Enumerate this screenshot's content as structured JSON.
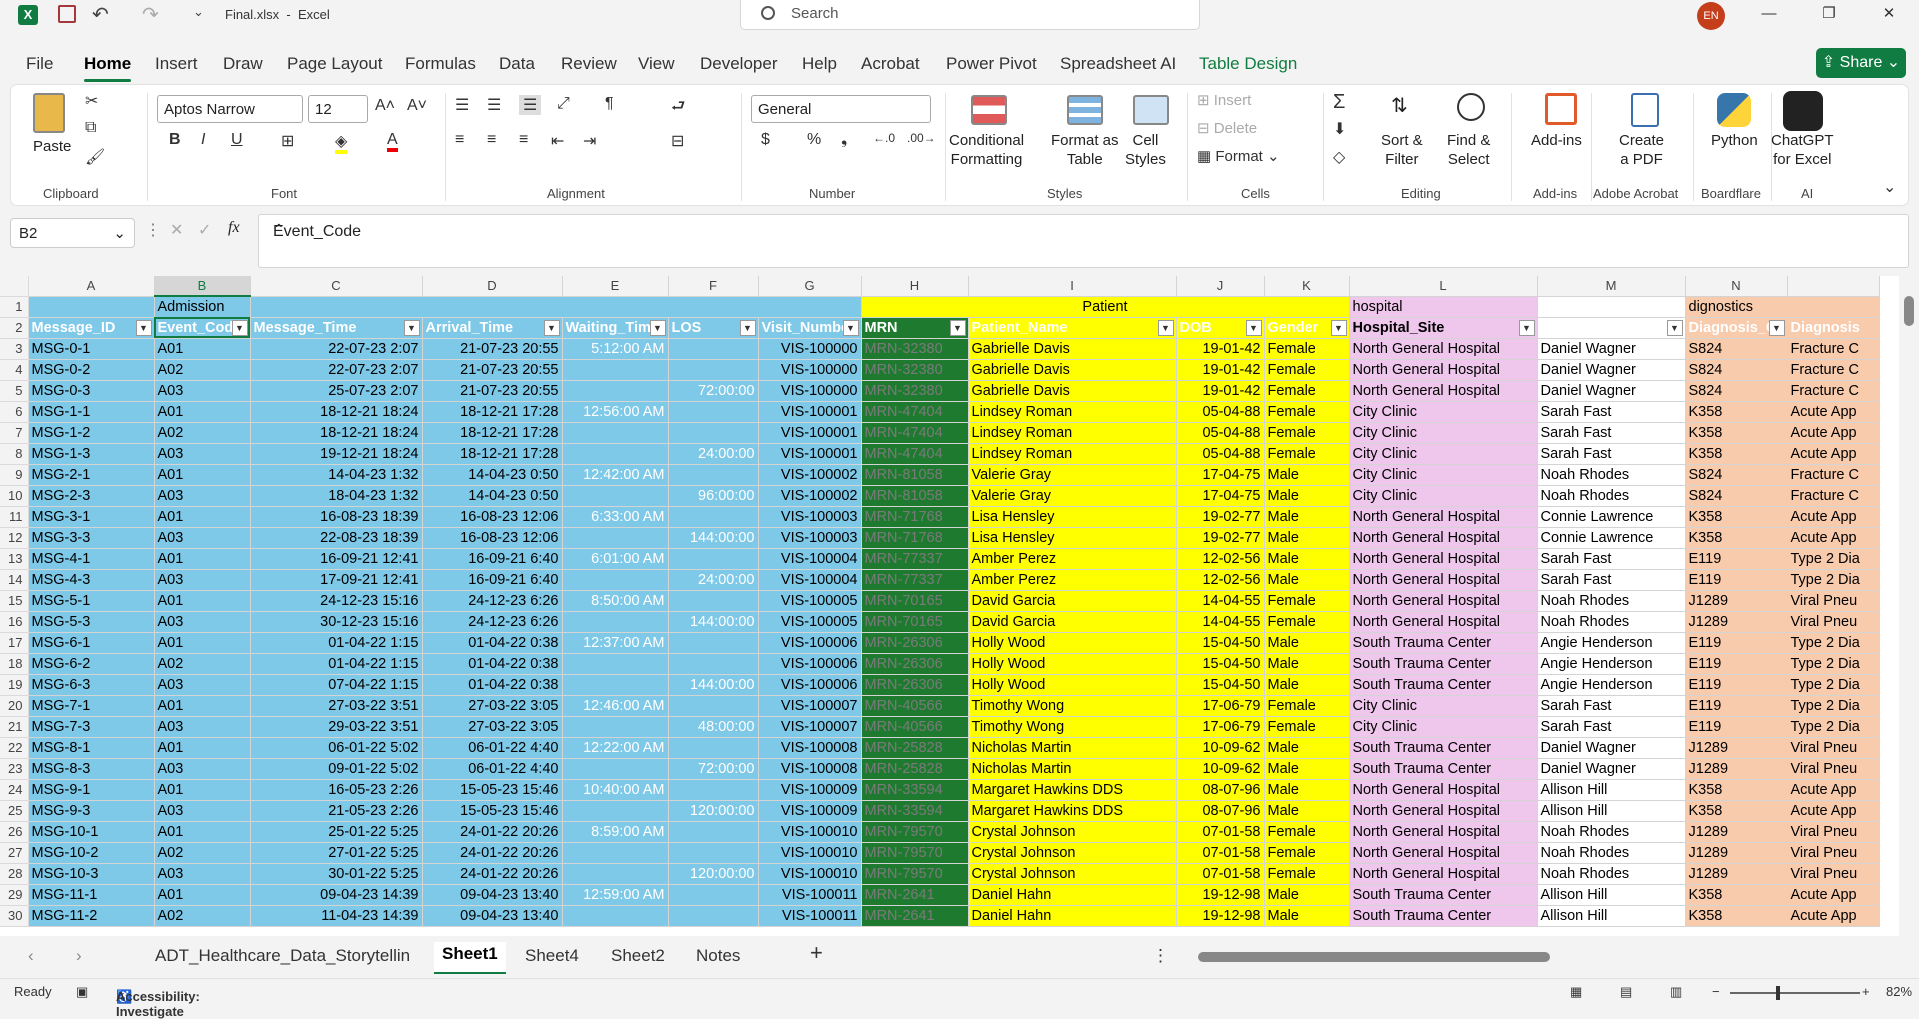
{
  "title": {
    "file": "Final.xlsx",
    "app": "Excel",
    "search": "Search",
    "user": "EN"
  },
  "menu": [
    "File",
    "Home",
    "Insert",
    "Draw",
    "Page Layout",
    "Formulas",
    "Data",
    "Review",
    "View",
    "Developer",
    "Help",
    "Acrobat",
    "Power Pivot",
    "Spreadsheet AI",
    "Table Design"
  ],
  "share": "Share",
  "ribbon": {
    "clipboard": {
      "label": "Clipboard",
      "paste": "Paste"
    },
    "font": {
      "label": "Font",
      "name": "Aptos Narrow",
      "size": "12"
    },
    "alignment": {
      "label": "Alignment"
    },
    "number": {
      "label": "Number",
      "format": "General"
    },
    "styles": {
      "label": "Styles",
      "conditional": "Conditional\nFormatting",
      "format_table": "Format as\nTable",
      "cell_styles": "Cell\nStyles"
    },
    "cells": {
      "label": "Cells",
      "insert": "Insert",
      "delete": "Delete",
      "format": "Format"
    },
    "editing": {
      "label": "Editing",
      "sort": "Sort &\nFilter",
      "find": "Find &\nSelect"
    },
    "addins": {
      "label": "Add-ins",
      "btn": "Add-ins"
    },
    "acrobat": {
      "label": "Adobe Acrobat",
      "btn": "Create\na PDF"
    },
    "boardflare": {
      "label": "Boardflare",
      "btn": "Python"
    },
    "ai": {
      "label": "AI",
      "btn": "ChatGPT\nfor Excel"
    }
  },
  "formula": {
    "cell": "B2",
    "value": "Event_Code"
  },
  "columns": [
    "A",
    "B",
    "C",
    "D",
    "E",
    "F",
    "G",
    "H",
    "I",
    "J",
    "K",
    "L",
    "M",
    "N"
  ],
  "group_headers": {
    "admission": "Admission",
    "patient": "Patient",
    "hospital": "hospital",
    "diagnostics": "dignostics"
  },
  "headers": [
    "Message_ID",
    "Event_Cod",
    "Message_Time",
    "Arrival_Time",
    "Waiting_Tim",
    "LOS",
    "Visit_Numbe",
    "MRN",
    "Patient_Name",
    "DOB",
    "Gender",
    "Hospital_Site",
    "",
    "Diagnosis_C",
    "Diagnosis"
  ],
  "rows": [
    [
      "MSG-0-1",
      "A01",
      "22-07-23 2:07",
      "21-07-23 20:55",
      "5:12:00 AM",
      "",
      "VIS-100000",
      "MRN-32380",
      "Gabrielle Davis",
      "19-01-42",
      "Female",
      "North General Hospital",
      "Daniel Wagner",
      "S824",
      "Fracture C"
    ],
    [
      "MSG-0-2",
      "A02",
      "22-07-23 2:07",
      "21-07-23 20:55",
      "",
      "",
      "VIS-100000",
      "MRN-32380",
      "Gabrielle Davis",
      "19-01-42",
      "Female",
      "North General Hospital",
      "Daniel Wagner",
      "S824",
      "Fracture C"
    ],
    [
      "MSG-0-3",
      "A03",
      "25-07-23 2:07",
      "21-07-23 20:55",
      "",
      "72:00:00",
      "VIS-100000",
      "MRN-32380",
      "Gabrielle Davis",
      "19-01-42",
      "Female",
      "North General Hospital",
      "Daniel Wagner",
      "S824",
      "Fracture C"
    ],
    [
      "MSG-1-1",
      "A01",
      "18-12-21 18:24",
      "18-12-21 17:28",
      "12:56:00 AM",
      "",
      "VIS-100001",
      "MRN-47404",
      "Lindsey Roman",
      "05-04-88",
      "Female",
      "City Clinic",
      "Sarah Fast",
      "K358",
      "Acute App"
    ],
    [
      "MSG-1-2",
      "A02",
      "18-12-21 18:24",
      "18-12-21 17:28",
      "",
      "",
      "VIS-100001",
      "MRN-47404",
      "Lindsey Roman",
      "05-04-88",
      "Female",
      "City Clinic",
      "Sarah Fast",
      "K358",
      "Acute App"
    ],
    [
      "MSG-1-3",
      "A03",
      "19-12-21 18:24",
      "18-12-21 17:28",
      "",
      "24:00:00",
      "VIS-100001",
      "MRN-47404",
      "Lindsey Roman",
      "05-04-88",
      "Female",
      "City Clinic",
      "Sarah Fast",
      "K358",
      "Acute App"
    ],
    [
      "MSG-2-1",
      "A01",
      "14-04-23 1:32",
      "14-04-23 0:50",
      "12:42:00 AM",
      "",
      "VIS-100002",
      "MRN-81058",
      "Valerie Gray",
      "17-04-75",
      "Male",
      "City Clinic",
      "Noah Rhodes",
      "S824",
      "Fracture C"
    ],
    [
      "MSG-2-3",
      "A03",
      "18-04-23 1:32",
      "14-04-23 0:50",
      "",
      "96:00:00",
      "VIS-100002",
      "MRN-81058",
      "Valerie Gray",
      "17-04-75",
      "Male",
      "City Clinic",
      "Noah Rhodes",
      "S824",
      "Fracture C"
    ],
    [
      "MSG-3-1",
      "A01",
      "16-08-23 18:39",
      "16-08-23 12:06",
      "6:33:00 AM",
      "",
      "VIS-100003",
      "MRN-71768",
      "Lisa Hensley",
      "19-02-77",
      "Male",
      "North General Hospital",
      "Connie Lawrence",
      "K358",
      "Acute App"
    ],
    [
      "MSG-3-3",
      "A03",
      "22-08-23 18:39",
      "16-08-23 12:06",
      "",
      "144:00:00",
      "VIS-100003",
      "MRN-71768",
      "Lisa Hensley",
      "19-02-77",
      "Male",
      "North General Hospital",
      "Connie Lawrence",
      "K358",
      "Acute App"
    ],
    [
      "MSG-4-1",
      "A01",
      "16-09-21 12:41",
      "16-09-21 6:40",
      "6:01:00 AM",
      "",
      "VIS-100004",
      "MRN-77337",
      "Amber Perez",
      "12-02-56",
      "Male",
      "North General Hospital",
      "Sarah Fast",
      "E119",
      "Type 2 Dia"
    ],
    [
      "MSG-4-3",
      "A03",
      "17-09-21 12:41",
      "16-09-21 6:40",
      "",
      "24:00:00",
      "VIS-100004",
      "MRN-77337",
      "Amber Perez",
      "12-02-56",
      "Male",
      "North General Hospital",
      "Sarah Fast",
      "E119",
      "Type 2 Dia"
    ],
    [
      "MSG-5-1",
      "A01",
      "24-12-23 15:16",
      "24-12-23 6:26",
      "8:50:00 AM",
      "",
      "VIS-100005",
      "MRN-70165",
      "David Garcia",
      "14-04-55",
      "Female",
      "North General Hospital",
      "Noah Rhodes",
      "J1289",
      "Viral Pneu"
    ],
    [
      "MSG-5-3",
      "A03",
      "30-12-23 15:16",
      "24-12-23 6:26",
      "",
      "144:00:00",
      "VIS-100005",
      "MRN-70165",
      "David Garcia",
      "14-04-55",
      "Female",
      "North General Hospital",
      "Noah Rhodes",
      "J1289",
      "Viral Pneu"
    ],
    [
      "MSG-6-1",
      "A01",
      "01-04-22 1:15",
      "01-04-22 0:38",
      "12:37:00 AM",
      "",
      "VIS-100006",
      "MRN-26306",
      "Holly Wood",
      "15-04-50",
      "Male",
      "South Trauma Center",
      "Angie Henderson",
      "E119",
      "Type 2 Dia"
    ],
    [
      "MSG-6-2",
      "A02",
      "01-04-22 1:15",
      "01-04-22 0:38",
      "",
      "",
      "VIS-100006",
      "MRN-26306",
      "Holly Wood",
      "15-04-50",
      "Male",
      "South Trauma Center",
      "Angie Henderson",
      "E119",
      "Type 2 Dia"
    ],
    [
      "MSG-6-3",
      "A03",
      "07-04-22 1:15",
      "01-04-22 0:38",
      "",
      "144:00:00",
      "VIS-100006",
      "MRN-26306",
      "Holly Wood",
      "15-04-50",
      "Male",
      "South Trauma Center",
      "Angie Henderson",
      "E119",
      "Type 2 Dia"
    ],
    [
      "MSG-7-1",
      "A01",
      "27-03-22 3:51",
      "27-03-22 3:05",
      "12:46:00 AM",
      "",
      "VIS-100007",
      "MRN-40566",
      "Timothy Wong",
      "17-06-79",
      "Female",
      "City Clinic",
      "Sarah Fast",
      "E119",
      "Type 2 Dia"
    ],
    [
      "MSG-7-3",
      "A03",
      "29-03-22 3:51",
      "27-03-22 3:05",
      "",
      "48:00:00",
      "VIS-100007",
      "MRN-40566",
      "Timothy Wong",
      "17-06-79",
      "Female",
      "City Clinic",
      "Sarah Fast",
      "E119",
      "Type 2 Dia"
    ],
    [
      "MSG-8-1",
      "A01",
      "06-01-22 5:02",
      "06-01-22 4:40",
      "12:22:00 AM",
      "",
      "VIS-100008",
      "MRN-25828",
      "Nicholas Martin",
      "10-09-62",
      "Male",
      "South Trauma Center",
      "Daniel Wagner",
      "J1289",
      "Viral Pneu"
    ],
    [
      "MSG-8-3",
      "A03",
      "09-01-22 5:02",
      "06-01-22 4:40",
      "",
      "72:00:00",
      "VIS-100008",
      "MRN-25828",
      "Nicholas Martin",
      "10-09-62",
      "Male",
      "South Trauma Center",
      "Daniel Wagner",
      "J1289",
      "Viral Pneu"
    ],
    [
      "MSG-9-1",
      "A01",
      "16-05-23 2:26",
      "15-05-23 15:46",
      "10:40:00 AM",
      "",
      "VIS-100009",
      "MRN-33594",
      "Margaret Hawkins DDS",
      "08-07-96",
      "Male",
      "North General Hospital",
      "Allison Hill",
      "K358",
      "Acute App"
    ],
    [
      "MSG-9-3",
      "A03",
      "21-05-23 2:26",
      "15-05-23 15:46",
      "",
      "120:00:00",
      "VIS-100009",
      "MRN-33594",
      "Margaret Hawkins DDS",
      "08-07-96",
      "Male",
      "North General Hospital",
      "Allison Hill",
      "K358",
      "Acute App"
    ],
    [
      "MSG-10-1",
      "A01",
      "25-01-22 5:25",
      "24-01-22 20:26",
      "8:59:00 AM",
      "",
      "VIS-100010",
      "MRN-79570",
      "Crystal Johnson",
      "07-01-58",
      "Female",
      "North General Hospital",
      "Noah Rhodes",
      "J1289",
      "Viral Pneu"
    ],
    [
      "MSG-10-2",
      "A02",
      "27-01-22 5:25",
      "24-01-22 20:26",
      "",
      "",
      "VIS-100010",
      "MRN-79570",
      "Crystal Johnson",
      "07-01-58",
      "Female",
      "North General Hospital",
      "Noah Rhodes",
      "J1289",
      "Viral Pneu"
    ],
    [
      "MSG-10-3",
      "A03",
      "30-01-22 5:25",
      "24-01-22 20:26",
      "",
      "120:00:00",
      "VIS-100010",
      "MRN-79570",
      "Crystal Johnson",
      "07-01-58",
      "Female",
      "North General Hospital",
      "Noah Rhodes",
      "J1289",
      "Viral Pneu"
    ],
    [
      "MSG-11-1",
      "A01",
      "09-04-23 14:39",
      "09-04-23 13:40",
      "12:59:00 AM",
      "",
      "VIS-100011",
      "MRN-2641",
      "Daniel Hahn",
      "19-12-98",
      "Male",
      "South Trauma Center",
      "Allison Hill",
      "K358",
      "Acute App"
    ],
    [
      "MSG-11-2",
      "A02",
      "11-04-23 14:39",
      "09-04-23 13:40",
      "",
      "",
      "VIS-100011",
      "MRN-2641",
      "Daniel Hahn",
      "19-12-98",
      "Male",
      "South Trauma Center",
      "Allison Hill",
      "K358",
      "Acute App"
    ]
  ],
  "sheets": [
    "ADT_Healthcare_Data_Storytellin",
    "Sheet1",
    "Sheet4",
    "Sheet2",
    "Notes"
  ],
  "active_sheet": "Sheet1",
  "status": {
    "ready": "Ready",
    "accessibility": "Accessibility: Investigate",
    "zoom": "82%"
  },
  "colors": {
    "admission": "#7ec8e8",
    "mrn": "#1e7a2f",
    "patient": "#ffff00",
    "hospital": "#efc6ec",
    "diagnostics": "#f8cbad",
    "accent": "#107c41"
  },
  "icons": [
    "save-icon",
    "undo-icon",
    "redo-icon",
    "search-icon",
    "minimize-icon",
    "maximize-icon",
    "close-icon",
    "filter-dropdown-icon",
    "add-sheet-icon"
  ]
}
